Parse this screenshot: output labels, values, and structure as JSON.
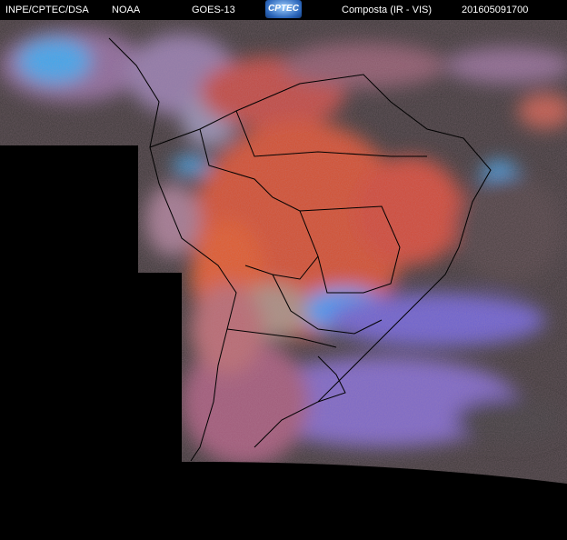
{
  "header": {
    "agency": "INPE/CPTEC/DSA",
    "source": "NOAA",
    "satellite": "GOES-13",
    "logo_text": "CPTEC",
    "product": "Composta (IR - VIS)",
    "timestamp": "201605091700"
  },
  "colors": {
    "background": "#000000",
    "ocean_clear": "#3a3a3a",
    "land_warm": "#d2502e",
    "cloud_high": "#33aaff",
    "cloud_mid": "#7a6ad8"
  }
}
